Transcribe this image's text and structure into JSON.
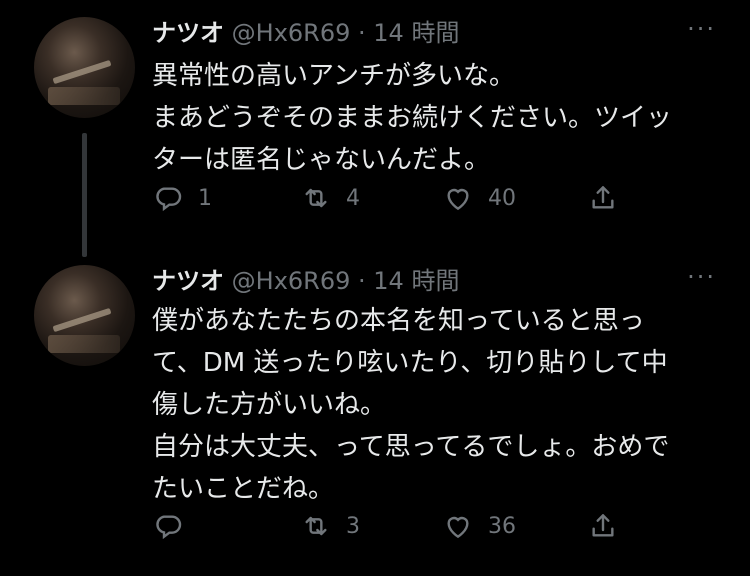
{
  "tweets": [
    {
      "name": "ナツオ",
      "handle": "@Hx6R69",
      "time": "· 14 時間",
      "more": "···",
      "lines": [
        "異常性の高いアンチが多いな。",
        "まあどうぞそのままお続けください。ツイッ",
        "ターは匿名じゃないんだよ。"
      ],
      "reply_count": "1",
      "retweet_count": "4",
      "like_count": "40",
      "icons": [
        "reply-icon",
        "retweet-icon",
        "like-icon",
        "share-icon"
      ]
    },
    {
      "name": "ナツオ",
      "handle": "@Hx6R69",
      "time": "· 14 時間",
      "more": "···",
      "lines": [
        "僕があなたたちの本名を知っていると思っ",
        "て、DM 送ったり呟いたり、切り貼りして中",
        "傷した方がいいね。",
        "自分は大丈夫、って思ってるでしょ。おめで",
        "たいことだね。"
      ],
      "reply_count": "",
      "retweet_count": "3",
      "like_count": "36",
      "icons": [
        "reply-icon",
        "retweet-icon",
        "like-icon",
        "share-icon"
      ]
    }
  ],
  "colors": {
    "background": "#000000",
    "text": "#e7e9ea",
    "muted": "#71767b",
    "thread_line": "#333639"
  }
}
